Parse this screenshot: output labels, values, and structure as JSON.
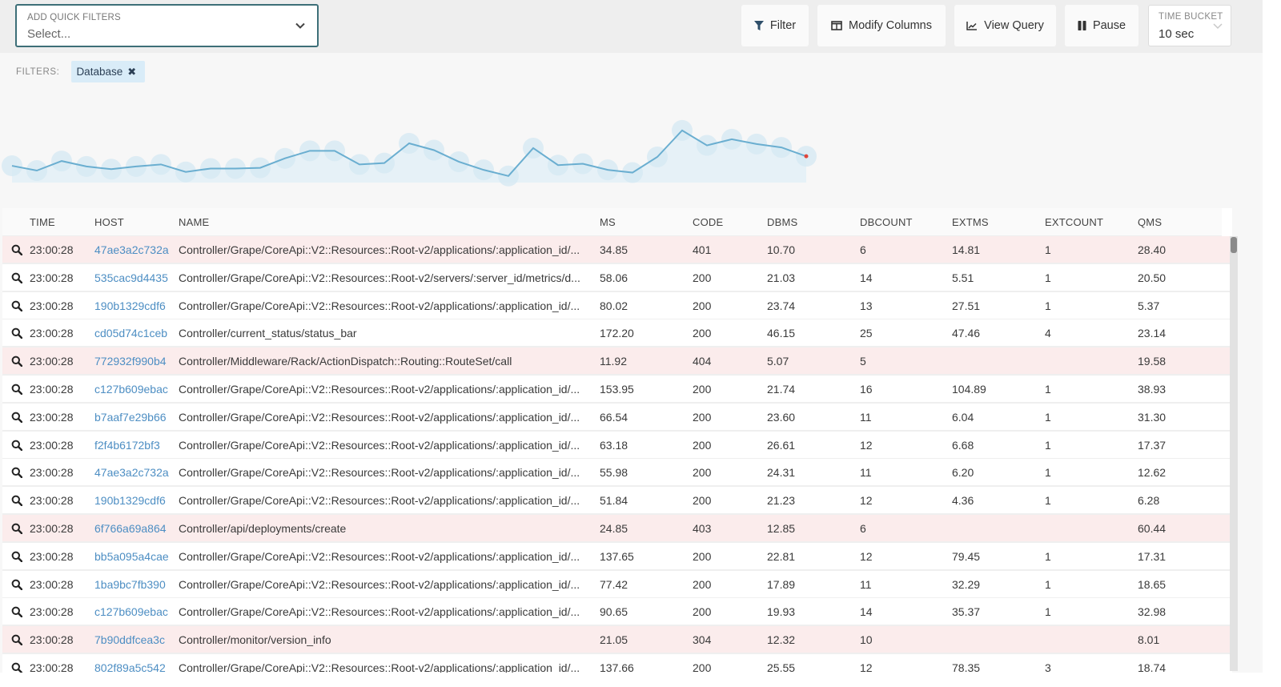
{
  "toolbar": {
    "quick_filters": {
      "label": "ADD QUICK FILTERS",
      "placeholder": "Select..."
    },
    "buttons": {
      "filter": "Filter",
      "modify_columns": "Modify Columns",
      "view_query": "View Query",
      "pause": "Pause"
    },
    "time_bucket": {
      "label": "TIME BUCKET",
      "value": "10 sec"
    }
  },
  "filters": {
    "label": "FILTERS:",
    "chips": [
      {
        "label": "Database",
        "remove_icon": "close-icon"
      }
    ]
  },
  "sparkline": {
    "series_color": "#6aaed0",
    "highlight_color": "#e0453a",
    "values": [
      27,
      20,
      34,
      26,
      22,
      26,
      29,
      18,
      23,
      23,
      24,
      38,
      49,
      49,
      29,
      31,
      60,
      50,
      33,
      21,
      12,
      53,
      28,
      30,
      21,
      17,
      40,
      79,
      57,
      66,
      59,
      54,
      41
    ]
  },
  "table": {
    "columns": [
      "TIME",
      "HOST",
      "NAME",
      "MS",
      "CODE",
      "DBMS",
      "DBCOUNT",
      "EXTMS",
      "EXTCOUNT",
      "QMS"
    ],
    "rows": [
      {
        "time": "23:00:28",
        "host": "47ae3a2c732a",
        "name": "Controller/Grape/CoreApi::V2::Resources::Root-v2/applications/:application_id/...",
        "ms": "34.85",
        "code": "401",
        "dbms": "10.70",
        "dbcount": "6",
        "extms": "14.81",
        "extcount": "1",
        "qms": "28.40",
        "error": true
      },
      {
        "time": "23:00:28",
        "host": "535cac9d4435",
        "name": "Controller/Grape/CoreApi::V2::Resources::Root-v2/servers/:server_id/metrics/d...",
        "ms": "58.06",
        "code": "200",
        "dbms": "21.03",
        "dbcount": "14",
        "extms": "5.51",
        "extcount": "1",
        "qms": "20.50",
        "error": false
      },
      {
        "time": "23:00:28",
        "host": "190b1329cdf6",
        "name": "Controller/Grape/CoreApi::V2::Resources::Root-v2/applications/:application_id/...",
        "ms": "80.02",
        "code": "200",
        "dbms": "23.74",
        "dbcount": "13",
        "extms": "27.51",
        "extcount": "1",
        "qms": "5.37",
        "error": false
      },
      {
        "time": "23:00:28",
        "host": "cd05d74c1ceb",
        "name": "Controller/current_status/status_bar",
        "ms": "172.20",
        "code": "200",
        "dbms": "46.15",
        "dbcount": "25",
        "extms": "47.46",
        "extcount": "4",
        "qms": "23.14",
        "error": false
      },
      {
        "time": "23:00:28",
        "host": "772932f990b4",
        "name": "Controller/Middleware/Rack/ActionDispatch::Routing::RouteSet/call",
        "ms": "11.92",
        "code": "404",
        "dbms": "5.07",
        "dbcount": "5",
        "extms": "",
        "extcount": "",
        "qms": "19.58",
        "error": true
      },
      {
        "time": "23:00:28",
        "host": "c127b609ebac",
        "name": "Controller/Grape/CoreApi::V2::Resources::Root-v2/applications/:application_id/...",
        "ms": "153.95",
        "code": "200",
        "dbms": "21.74",
        "dbcount": "16",
        "extms": "104.89",
        "extcount": "1",
        "qms": "38.93",
        "error": false
      },
      {
        "time": "23:00:28",
        "host": "b7aaf7e29b66",
        "name": "Controller/Grape/CoreApi::V2::Resources::Root-v2/applications/:application_id/...",
        "ms": "66.54",
        "code": "200",
        "dbms": "23.60",
        "dbcount": "11",
        "extms": "6.04",
        "extcount": "1",
        "qms": "31.30",
        "error": false
      },
      {
        "time": "23:00:28",
        "host": "f2f4b6172bf3",
        "name": "Controller/Grape/CoreApi::V2::Resources::Root-v2/applications/:application_id/...",
        "ms": "63.18",
        "code": "200",
        "dbms": "26.61",
        "dbcount": "12",
        "extms": "6.68",
        "extcount": "1",
        "qms": "17.37",
        "error": false
      },
      {
        "time": "23:00:28",
        "host": "47ae3a2c732a",
        "name": "Controller/Grape/CoreApi::V2::Resources::Root-v2/applications/:application_id/...",
        "ms": "55.98",
        "code": "200",
        "dbms": "24.31",
        "dbcount": "11",
        "extms": "6.20",
        "extcount": "1",
        "qms": "12.62",
        "error": false
      },
      {
        "time": "23:00:28",
        "host": "190b1329cdf6",
        "name": "Controller/Grape/CoreApi::V2::Resources::Root-v2/applications/:application_id/...",
        "ms": "51.84",
        "code": "200",
        "dbms": "21.23",
        "dbcount": "12",
        "extms": "4.36",
        "extcount": "1",
        "qms": "6.28",
        "error": false
      },
      {
        "time": "23:00:28",
        "host": "6f766a69a864",
        "name": "Controller/api/deployments/create",
        "ms": "24.85",
        "code": "403",
        "dbms": "12.85",
        "dbcount": "6",
        "extms": "",
        "extcount": "",
        "qms": "60.44",
        "error": true
      },
      {
        "time": "23:00:28",
        "host": "bb5a095a4cae",
        "name": "Controller/Grape/CoreApi::V2::Resources::Root-v2/applications/:application_id/...",
        "ms": "137.65",
        "code": "200",
        "dbms": "22.81",
        "dbcount": "12",
        "extms": "79.45",
        "extcount": "1",
        "qms": "17.31",
        "error": false
      },
      {
        "time": "23:00:28",
        "host": "1ba9bc7fb390",
        "name": "Controller/Grape/CoreApi::V2::Resources::Root-v2/applications/:application_id/...",
        "ms": "77.42",
        "code": "200",
        "dbms": "17.89",
        "dbcount": "11",
        "extms": "32.29",
        "extcount": "1",
        "qms": "18.65",
        "error": false
      },
      {
        "time": "23:00:28",
        "host": "c127b609ebac",
        "name": "Controller/Grape/CoreApi::V2::Resources::Root-v2/applications/:application_id/...",
        "ms": "90.65",
        "code": "200",
        "dbms": "19.93",
        "dbcount": "14",
        "extms": "35.37",
        "extcount": "1",
        "qms": "32.98",
        "error": false
      },
      {
        "time": "23:00:28",
        "host": "7b90ddfcea3c",
        "name": "Controller/monitor/version_info",
        "ms": "21.05",
        "code": "304",
        "dbms": "12.32",
        "dbcount": "10",
        "extms": "",
        "extcount": "",
        "qms": "8.01",
        "error": true
      },
      {
        "time": "23:00:28",
        "host": "802f89a5c542",
        "name": "Controller/Grape/CoreApi::V2::Resources::Root-v2/applications/:application_id/...",
        "ms": "137.66",
        "code": "200",
        "dbms": "25.55",
        "dbcount": "12",
        "extms": "78.35",
        "extcount": "3",
        "qms": "18.74",
        "error": false
      }
    ]
  },
  "colors": {
    "accent_border": "#3d6f78",
    "host_link": "#4d8ec3",
    "error_row": "#fbecec",
    "chip_bg": "#d9ecf8"
  }
}
